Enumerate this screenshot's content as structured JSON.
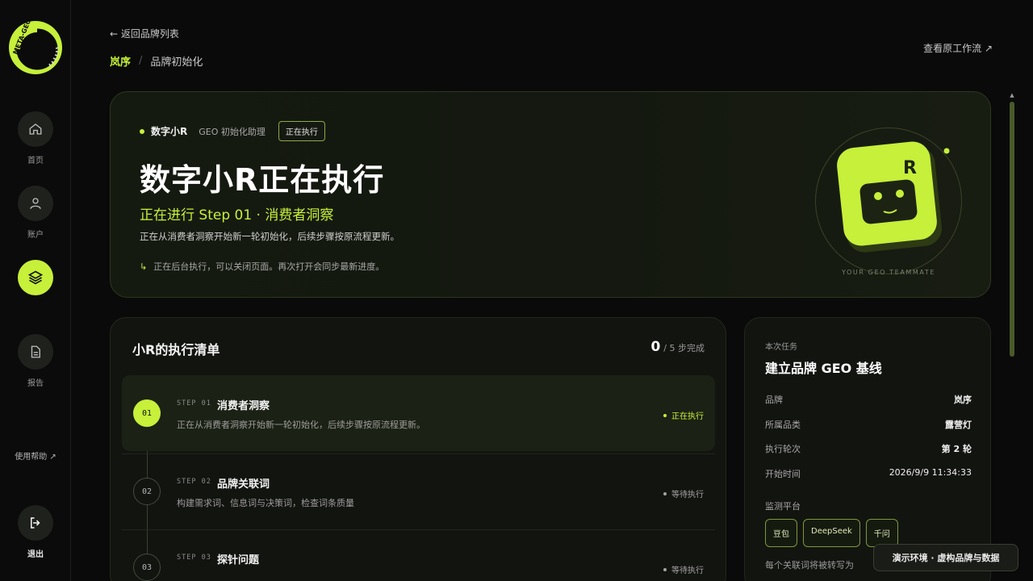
{
  "brand": {
    "logo_text": "META-GEO",
    "accent": "#c6f03a"
  },
  "sidebar": {
    "items": [
      {
        "label": "首页",
        "icon": "home-icon"
      },
      {
        "label": "账户",
        "icon": "user-icon"
      },
      {
        "label": "",
        "icon": "layers-icon",
        "active": true
      },
      {
        "label": "报告",
        "icon": "document-icon"
      }
    ],
    "help_label": "使用帮助 ↗",
    "logout_label": "退出"
  },
  "header": {
    "back_label": "← 返回品牌列表",
    "breadcrumb": {
      "brand": "岚序",
      "separator": "/",
      "page": "品牌初始化"
    },
    "view_flow_label": "查看原工作流 ↗"
  },
  "hero": {
    "agent_name": "数字小R",
    "agent_role": "GEO 初始化助理",
    "badge": "正在执行",
    "title": "数字小R正在执行",
    "step_line": "正在进行 Step 01 · 消费者洞察",
    "description": "正在从消费者洞察开始新一轮初始化，后续步骤按原流程更新。",
    "note_arrow": "↳",
    "note": "正在后台执行，可以关闭页面。再次打开会同步最新进度。",
    "mascot_letter": "R",
    "mascot_caption": "YOUR GEO TEAMMATE"
  },
  "checklist": {
    "title": "小R的执行清单",
    "done": "0",
    "total_label": "/ 5 步完成",
    "steps": [
      {
        "num": "01",
        "kicker": "STEP 01",
        "name": "消费者洞察",
        "desc": "正在从消费者洞察开始新一轮初始化，后续步骤按原流程更新。",
        "status": "正在执行",
        "state": "running"
      },
      {
        "num": "02",
        "kicker": "STEP 02",
        "name": "品牌关联词",
        "desc": "构建需求词、信息词与决策词，检查词条质量",
        "status": "等待执行",
        "state": "waiting"
      },
      {
        "num": "03",
        "kicker": "STEP 03",
        "name": "探针问题",
        "desc": "",
        "status": "等待执行",
        "state": "waiting"
      }
    ]
  },
  "task": {
    "kicker": "本次任务",
    "title": "建立品牌 GEO 基线",
    "rows": [
      {
        "key": "品牌",
        "value": "岚序"
      },
      {
        "key": "所属品类",
        "value": "露营灯"
      },
      {
        "key": "执行轮次",
        "value": "第 2 轮"
      },
      {
        "key": "开始时间",
        "value": "2026/9/9 11:34:33"
      }
    ],
    "platform_label": "监测平台",
    "platforms": [
      "豆包",
      "DeepSeek",
      "千问"
    ],
    "more": "每个关联词将被转写为"
  },
  "demo_banner": "演示环境 · 虚构品牌与数据"
}
